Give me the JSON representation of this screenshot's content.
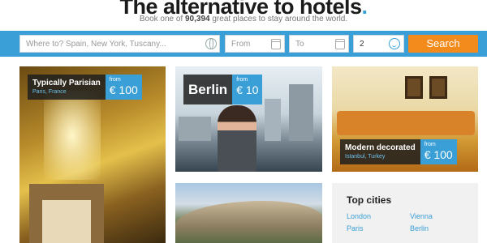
{
  "header": {
    "headline": "The alternative to hotels",
    "headline_dot": ".",
    "sub_pre": "Book one of ",
    "sub_count": "90,394",
    "sub_post": " great places to stay around the world."
  },
  "search": {
    "where_placeholder": "Where to? Spain, New York, Tuscany...",
    "from_placeholder": "From",
    "to_placeholder": "To",
    "guests_value": "2",
    "button_label": "Search"
  },
  "colors": {
    "accent": "#3a9fd6",
    "button": "#f28a1c"
  },
  "cards": [
    {
      "title": "Typically Parisian",
      "location": "Paris, France",
      "from": "from",
      "price": "€ 100"
    },
    {
      "title": "Berlin",
      "from": "from",
      "price": "€ 10"
    },
    {
      "title": "Modern decorated",
      "location": "Istanbul, Turkey",
      "from": "from",
      "price": "€ 100"
    }
  ],
  "top_cities": {
    "heading": "Top cities",
    "cities": [
      "London",
      "Vienna",
      "Paris",
      "Berlin"
    ]
  }
}
